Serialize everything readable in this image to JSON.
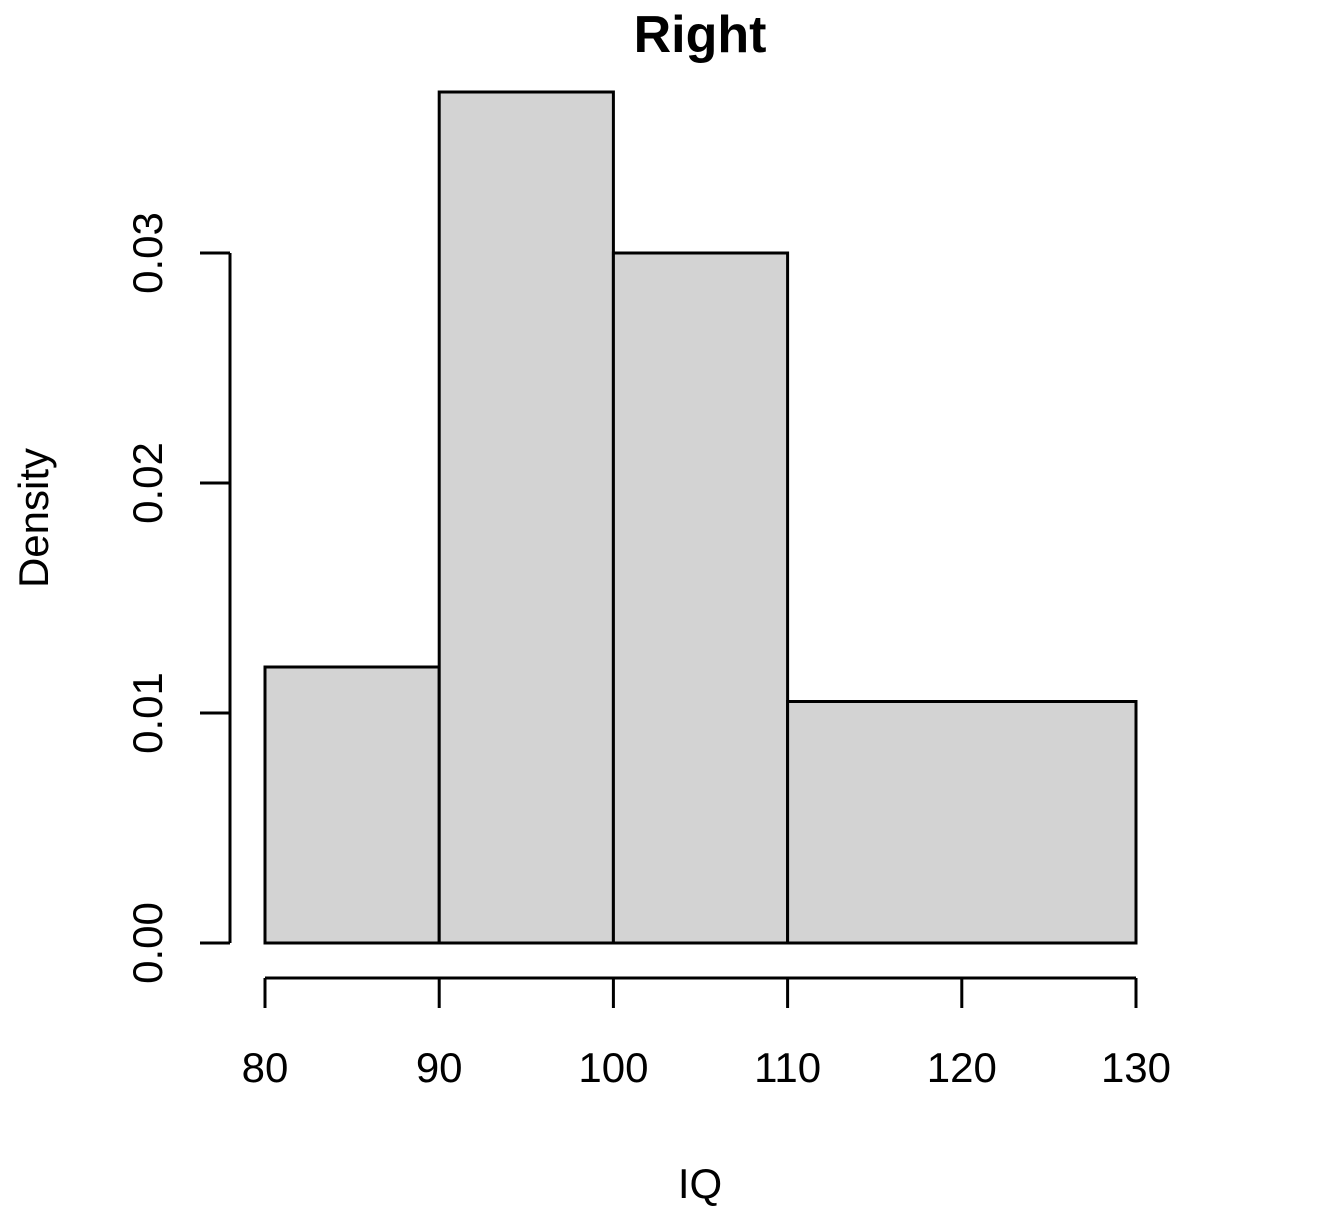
{
  "chart_data": {
    "type": "bar",
    "subtype": "histogram",
    "title": "Right",
    "xlabel": "IQ",
    "ylabel": "Density",
    "bins": [
      {
        "from": 80,
        "to": 90,
        "density": 0.012
      },
      {
        "from": 90,
        "to": 100,
        "density": 0.037
      },
      {
        "from": 100,
        "to": 110,
        "density": 0.03
      },
      {
        "from": 110,
        "to": 130,
        "density": 0.0105
      }
    ],
    "xlim": [
      80,
      130
    ],
    "ylim": [
      0,
      0.037
    ],
    "xticks": [
      80,
      90,
      100,
      110,
      120,
      130
    ],
    "xtick_labels": [
      "80",
      "90",
      "100",
      "110",
      "120",
      "130"
    ],
    "yticks": [
      0,
      0.01,
      0.02,
      0.03
    ],
    "ytick_labels": [
      "0.00",
      "0.01",
      "0.02",
      "0.03"
    ],
    "bar_fill": "#d3d3d3",
    "bar_stroke": "#000000",
    "grid": false,
    "legend": "none"
  }
}
